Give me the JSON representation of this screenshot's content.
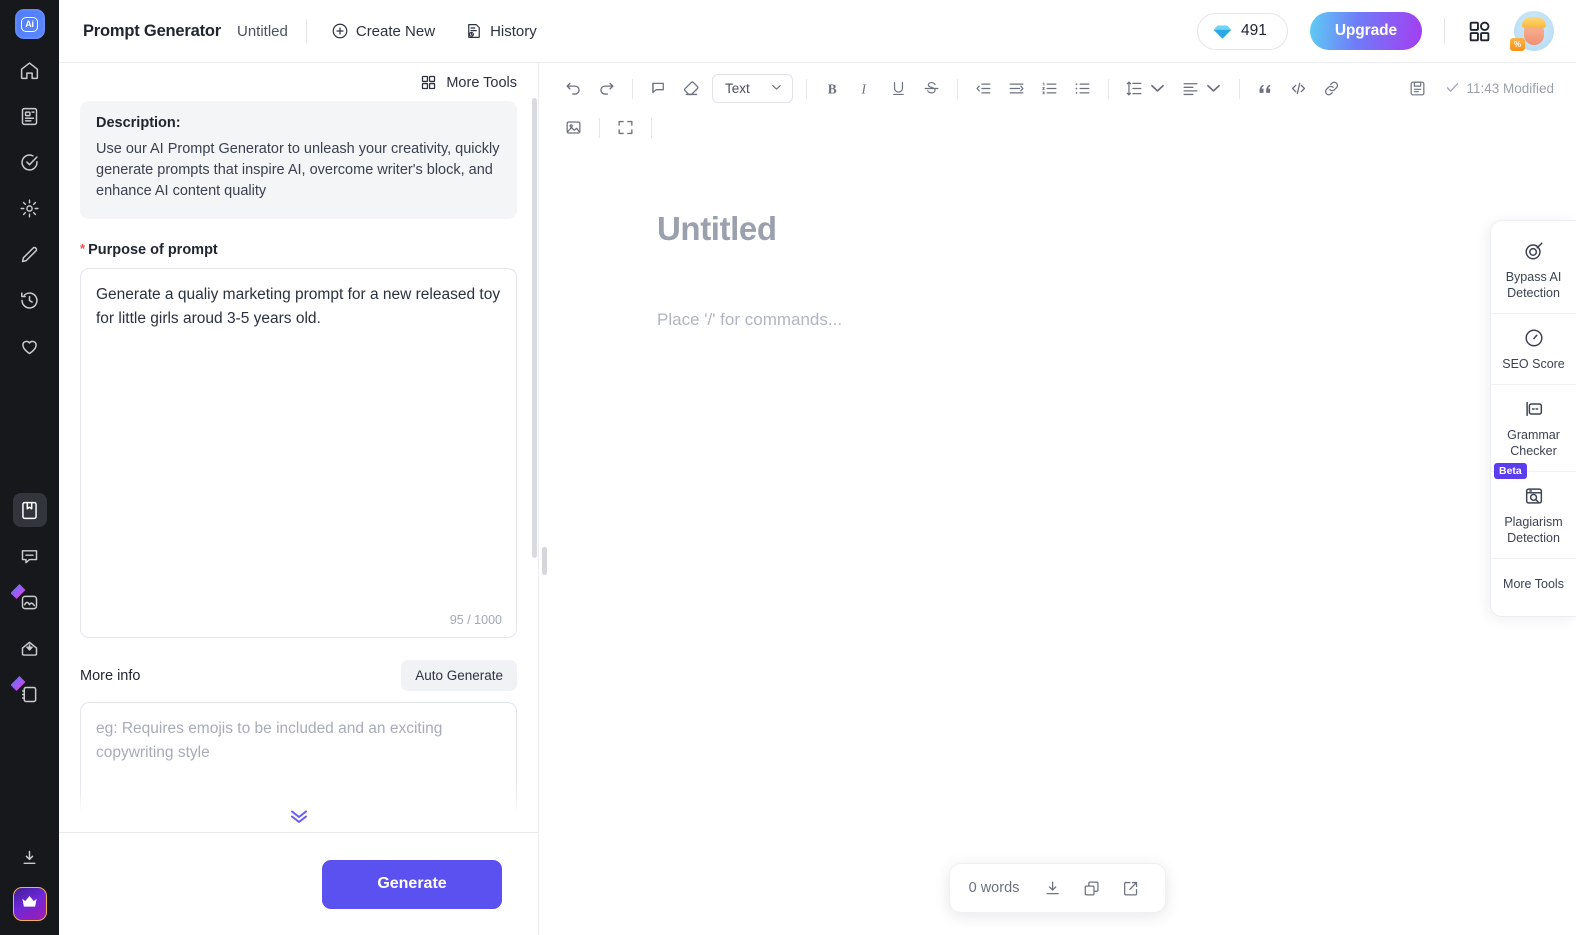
{
  "rail": {
    "logo": "Ai",
    "items_top": [
      {
        "name": "home",
        "label": "Home"
      },
      {
        "name": "documents",
        "label": "Documents"
      },
      {
        "name": "tasks",
        "label": "Tasks"
      },
      {
        "name": "settings",
        "label": "Settings"
      },
      {
        "name": "write",
        "label": "Write"
      },
      {
        "name": "history",
        "label": "History"
      },
      {
        "name": "favorites",
        "label": "Favorites"
      }
    ],
    "items_bottom": [
      {
        "name": "notebook",
        "label": "Notebook",
        "active": true,
        "spark": false
      },
      {
        "name": "chat",
        "label": "Chat",
        "active": false,
        "spark": false
      },
      {
        "name": "ai-image",
        "label": "AI Image",
        "active": false,
        "spark": true
      },
      {
        "name": "inbox",
        "label": "Inbox",
        "active": false,
        "spark": false
      },
      {
        "name": "ai-notes",
        "label": "AI Notes",
        "active": false,
        "spark": true
      }
    ],
    "download_label": "Download",
    "crown_label": "Premium"
  },
  "topbar": {
    "title": "Prompt Generator",
    "doc_name": "Untitled",
    "create_new": "Create New",
    "history": "History",
    "credits": "491",
    "upgrade": "Upgrade",
    "accent": "#5b50f0"
  },
  "left_panel": {
    "more_tools": "More Tools",
    "description_title": "Description:",
    "description_text": "Use our AI Prompt Generator to unleash your creativity, quickly generate prompts that inspire AI, overcome writer's block, and enhance AI content quality",
    "purpose_label": "Purpose of prompt",
    "purpose_required": "*",
    "purpose_value": "Generate a qualiy marketing prompt for a new released toy for little girls aroud 3-5 years old.",
    "purpose_counter": "95 / 1000",
    "more_info_label": "More info",
    "auto_generate": "Auto Generate",
    "more_info_placeholder": "eg: Requires emojis to be included and an exciting copywriting style",
    "generate": "Generate"
  },
  "editor": {
    "toolbar": {
      "undo": "Undo",
      "redo": "Redo",
      "comment": "Comment",
      "clear_format": "Clear formatting",
      "style_select": "Text",
      "bold": "Bold",
      "italic": "Italic",
      "underline": "Underline",
      "strikethrough": "Strikethrough",
      "outdent": "Decrease indent",
      "indent": "Increase indent",
      "ordered_list": "Numbered list",
      "bullet_list": "Bulleted list",
      "line_height": "Line spacing",
      "align": "Alignment",
      "quote": "Quote",
      "code": "Code block",
      "link": "Insert link",
      "save": "Save",
      "saved_status": "11:43 Modified",
      "image": "Insert image",
      "fullscreen": "Fullscreen"
    },
    "doc_title": "Untitled",
    "doc_placeholder": "Place '/' for commands...",
    "status": {
      "words": "0 words",
      "download": "Download",
      "copy": "Copy",
      "open_external": "Open in new window"
    }
  },
  "dock": {
    "items": [
      {
        "name": "bypass-ai-detection",
        "label": "Bypass AI Detection",
        "badge": ""
      },
      {
        "name": "seo-score",
        "label": "SEO Score",
        "badge": ""
      },
      {
        "name": "grammar-checker",
        "label": "Grammar Checker",
        "badge": ""
      },
      {
        "name": "plagiarism-detection",
        "label": "Plagiarism Detection",
        "badge": "Beta"
      },
      {
        "name": "more-tools",
        "label": "More Tools",
        "badge": ""
      }
    ],
    "badge_color": "#5b3df0"
  }
}
